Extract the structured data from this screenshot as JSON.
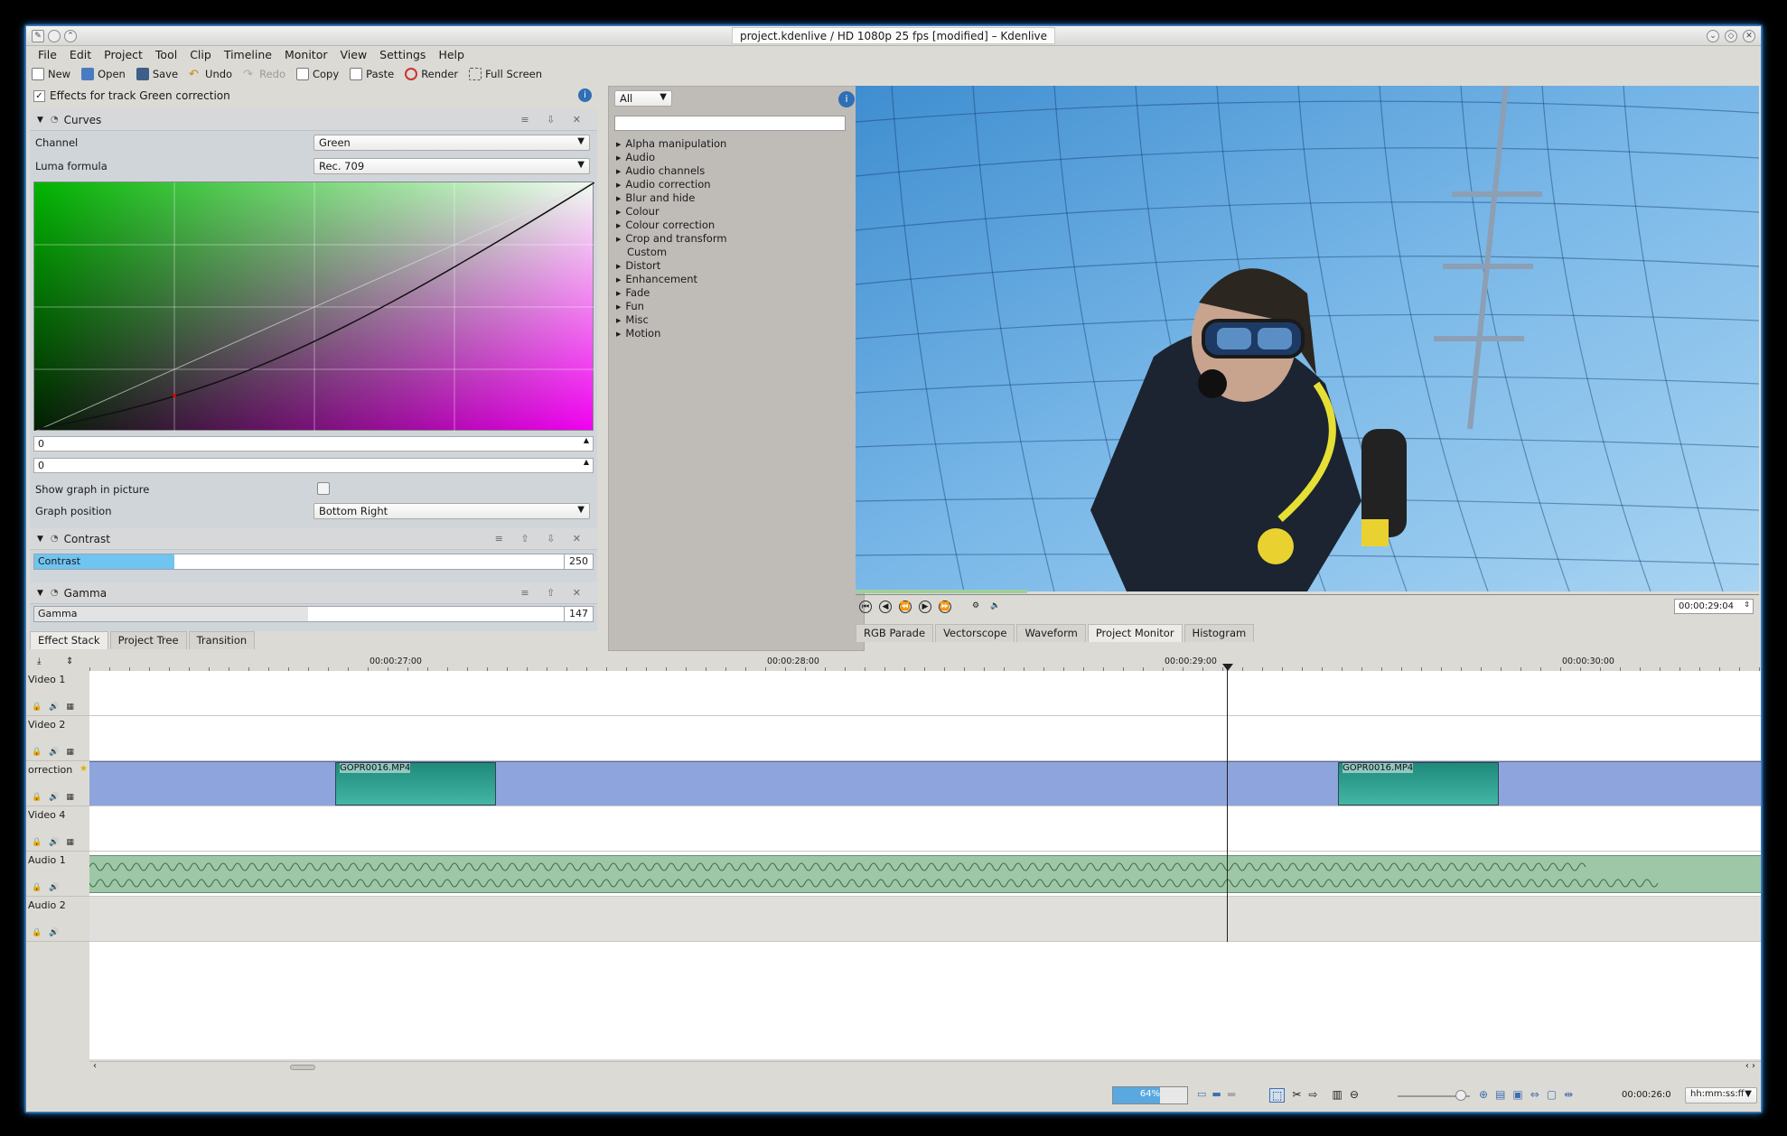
{
  "window": {
    "title": "project.kdenlive / HD 1080p 25 fps [modified] – Kdenlive"
  },
  "menu": [
    "File",
    "Edit",
    "Project",
    "Tool",
    "Clip",
    "Timeline",
    "Monitor",
    "View",
    "Settings",
    "Help"
  ],
  "toolbar": {
    "new": "New",
    "open": "Open",
    "save": "Save",
    "undo": "Undo",
    "redo": "Redo",
    "copy": "Copy",
    "paste": "Paste",
    "render": "Render",
    "fullscreen": "Full Screen"
  },
  "effect_stack": {
    "header": "Effects for track Green correction",
    "curves": {
      "title": "Curves",
      "channel_label": "Channel",
      "channel_value": "Green",
      "luma_label": "Luma formula",
      "luma_value": "Rec. 709",
      "spin1": "0",
      "spin2": "0",
      "show_graph_label": "Show graph in picture",
      "show_graph_checked": false,
      "graph_pos_label": "Graph position",
      "graph_pos_value": "Bottom Right"
    },
    "contrast": {
      "title": "Contrast",
      "slider_label": "Contrast",
      "value": "250",
      "fill_fraction": 0.25
    },
    "gamma": {
      "title": "Gamma",
      "slider_label": "Gamma",
      "value": "147",
      "fill_fraction": 0.49
    }
  },
  "left_tabs": [
    "Effect Stack",
    "Project Tree",
    "Transition"
  ],
  "effect_list": {
    "filter_value": "All",
    "search_placeholder": "",
    "items": [
      "Alpha manipulation",
      "Audio",
      "Audio channels",
      "Audio correction",
      "Blur and hide",
      "Colour",
      "Colour correction",
      "Crop and transform",
      "Custom",
      "Distort",
      "Enhancement",
      "Fade",
      "Fun",
      "Misc",
      "Motion"
    ]
  },
  "monitor": {
    "timecode": "00:00:29:04",
    "tabs": [
      "RGB Parade",
      "Vectorscope",
      "Waveform",
      "Project Monitor",
      "Histogram"
    ],
    "position_fraction": 0.19
  },
  "timeline": {
    "ruler": [
      "00:00:27:00",
      "00:00:28:00",
      "00:00:29:00",
      "00:00:30:00"
    ],
    "tracks": [
      {
        "name": "Video 1"
      },
      {
        "name": "Video 2"
      },
      {
        "name": "orrection"
      },
      {
        "name": "Video 4"
      },
      {
        "name": "Audio 1"
      },
      {
        "name": "Audio 2"
      }
    ],
    "clip_name": "GOPR0016.MP4"
  },
  "statusbar": {
    "progress": "64%",
    "progress_fraction": 0.64,
    "timecode": "00:00:26:0",
    "format": "hh:mm:ss:ff"
  },
  "colors": {
    "accent": "#6fc4f0",
    "clip_video": "#8ea4dc",
    "clip_audio": "#9dc7a6",
    "window_bg": "#dcdad5"
  }
}
